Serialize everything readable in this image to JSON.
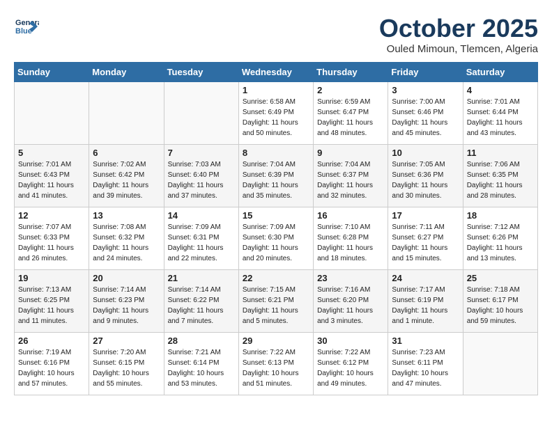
{
  "header": {
    "logo_line1": "General",
    "logo_line2": "Blue",
    "month": "October 2025",
    "location": "Ouled Mimoun, Tlemcen, Algeria"
  },
  "days_of_week": [
    "Sunday",
    "Monday",
    "Tuesday",
    "Wednesday",
    "Thursday",
    "Friday",
    "Saturday"
  ],
  "weeks": [
    [
      {
        "day": "",
        "info": ""
      },
      {
        "day": "",
        "info": ""
      },
      {
        "day": "",
        "info": ""
      },
      {
        "day": "1",
        "info": "Sunrise: 6:58 AM\nSunset: 6:49 PM\nDaylight: 11 hours\nand 50 minutes."
      },
      {
        "day": "2",
        "info": "Sunrise: 6:59 AM\nSunset: 6:47 PM\nDaylight: 11 hours\nand 48 minutes."
      },
      {
        "day": "3",
        "info": "Sunrise: 7:00 AM\nSunset: 6:46 PM\nDaylight: 11 hours\nand 45 minutes."
      },
      {
        "day": "4",
        "info": "Sunrise: 7:01 AM\nSunset: 6:44 PM\nDaylight: 11 hours\nand 43 minutes."
      }
    ],
    [
      {
        "day": "5",
        "info": "Sunrise: 7:01 AM\nSunset: 6:43 PM\nDaylight: 11 hours\nand 41 minutes."
      },
      {
        "day": "6",
        "info": "Sunrise: 7:02 AM\nSunset: 6:42 PM\nDaylight: 11 hours\nand 39 minutes."
      },
      {
        "day": "7",
        "info": "Sunrise: 7:03 AM\nSunset: 6:40 PM\nDaylight: 11 hours\nand 37 minutes."
      },
      {
        "day": "8",
        "info": "Sunrise: 7:04 AM\nSunset: 6:39 PM\nDaylight: 11 hours\nand 35 minutes."
      },
      {
        "day": "9",
        "info": "Sunrise: 7:04 AM\nSunset: 6:37 PM\nDaylight: 11 hours\nand 32 minutes."
      },
      {
        "day": "10",
        "info": "Sunrise: 7:05 AM\nSunset: 6:36 PM\nDaylight: 11 hours\nand 30 minutes."
      },
      {
        "day": "11",
        "info": "Sunrise: 7:06 AM\nSunset: 6:35 PM\nDaylight: 11 hours\nand 28 minutes."
      }
    ],
    [
      {
        "day": "12",
        "info": "Sunrise: 7:07 AM\nSunset: 6:33 PM\nDaylight: 11 hours\nand 26 minutes."
      },
      {
        "day": "13",
        "info": "Sunrise: 7:08 AM\nSunset: 6:32 PM\nDaylight: 11 hours\nand 24 minutes."
      },
      {
        "day": "14",
        "info": "Sunrise: 7:09 AM\nSunset: 6:31 PM\nDaylight: 11 hours\nand 22 minutes."
      },
      {
        "day": "15",
        "info": "Sunrise: 7:09 AM\nSunset: 6:30 PM\nDaylight: 11 hours\nand 20 minutes."
      },
      {
        "day": "16",
        "info": "Sunrise: 7:10 AM\nSunset: 6:28 PM\nDaylight: 11 hours\nand 18 minutes."
      },
      {
        "day": "17",
        "info": "Sunrise: 7:11 AM\nSunset: 6:27 PM\nDaylight: 11 hours\nand 15 minutes."
      },
      {
        "day": "18",
        "info": "Sunrise: 7:12 AM\nSunset: 6:26 PM\nDaylight: 11 hours\nand 13 minutes."
      }
    ],
    [
      {
        "day": "19",
        "info": "Sunrise: 7:13 AM\nSunset: 6:25 PM\nDaylight: 11 hours\nand 11 minutes."
      },
      {
        "day": "20",
        "info": "Sunrise: 7:14 AM\nSunset: 6:23 PM\nDaylight: 11 hours\nand 9 minutes."
      },
      {
        "day": "21",
        "info": "Sunrise: 7:14 AM\nSunset: 6:22 PM\nDaylight: 11 hours\nand 7 minutes."
      },
      {
        "day": "22",
        "info": "Sunrise: 7:15 AM\nSunset: 6:21 PM\nDaylight: 11 hours\nand 5 minutes."
      },
      {
        "day": "23",
        "info": "Sunrise: 7:16 AM\nSunset: 6:20 PM\nDaylight: 11 hours\nand 3 minutes."
      },
      {
        "day": "24",
        "info": "Sunrise: 7:17 AM\nSunset: 6:19 PM\nDaylight: 11 hours\nand 1 minute."
      },
      {
        "day": "25",
        "info": "Sunrise: 7:18 AM\nSunset: 6:17 PM\nDaylight: 10 hours\nand 59 minutes."
      }
    ],
    [
      {
        "day": "26",
        "info": "Sunrise: 7:19 AM\nSunset: 6:16 PM\nDaylight: 10 hours\nand 57 minutes."
      },
      {
        "day": "27",
        "info": "Sunrise: 7:20 AM\nSunset: 6:15 PM\nDaylight: 10 hours\nand 55 minutes."
      },
      {
        "day": "28",
        "info": "Sunrise: 7:21 AM\nSunset: 6:14 PM\nDaylight: 10 hours\nand 53 minutes."
      },
      {
        "day": "29",
        "info": "Sunrise: 7:22 AM\nSunset: 6:13 PM\nDaylight: 10 hours\nand 51 minutes."
      },
      {
        "day": "30",
        "info": "Sunrise: 7:22 AM\nSunset: 6:12 PM\nDaylight: 10 hours\nand 49 minutes."
      },
      {
        "day": "31",
        "info": "Sunrise: 7:23 AM\nSunset: 6:11 PM\nDaylight: 10 hours\nand 47 minutes."
      },
      {
        "day": "",
        "info": ""
      }
    ]
  ]
}
